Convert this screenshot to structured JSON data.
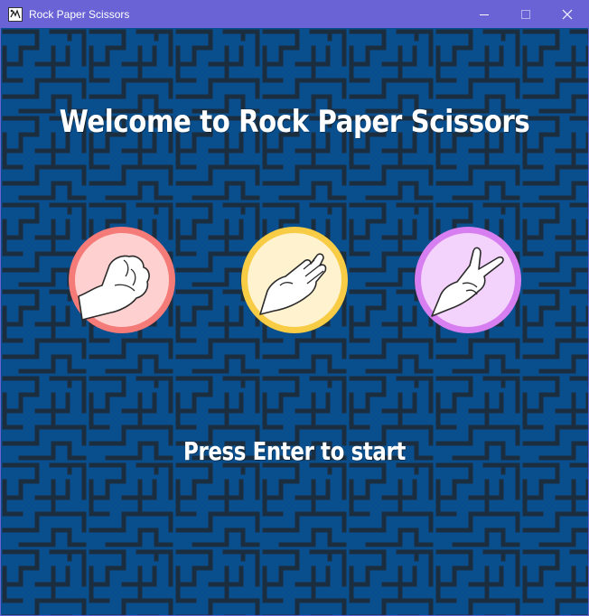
{
  "window": {
    "title": "Rock Paper Scissors",
    "controls": {
      "minimize_icon": "minimize-icon",
      "maximize_icon": "maximize-icon",
      "close_icon": "close-icon"
    }
  },
  "game": {
    "heading": "Welcome to Rock Paper Scissors",
    "prompt": "Press Enter to start",
    "choices": [
      {
        "name": "rock",
        "icon": "fist-hand-icon",
        "fill": "#ffd0d0",
        "ring": "#f47b78"
      },
      {
        "name": "paper",
        "icon": "open-hand-icon",
        "fill": "#fff2cf",
        "ring": "#f9cc45"
      },
      {
        "name": "scissors",
        "icon": "peace-hand-icon",
        "fill": "#f3d2fb",
        "ring": "#d77ef1"
      }
    ]
  },
  "colors": {
    "titlebar": "#6a63d6",
    "background": "#0a4f8f",
    "maze_lines": "#1d2a36",
    "text": "#ffffff"
  }
}
